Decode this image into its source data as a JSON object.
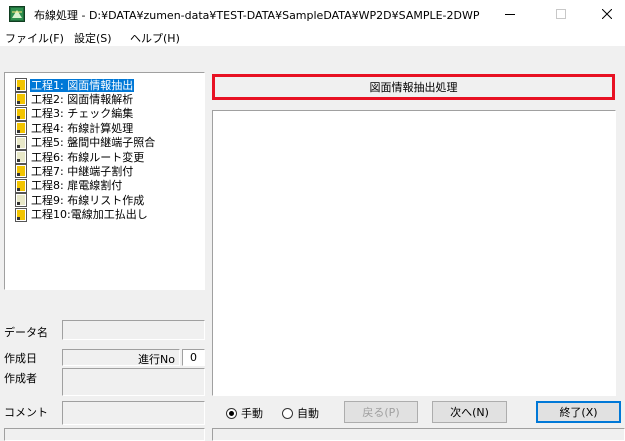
{
  "window": {
    "title": "布線処理 - D:¥DATA¥zumen-data¥TEST-DATA¥SampleDATA¥WP2D¥SAMPLE-2DWP",
    "app_icon": "app-icon",
    "controls": [
      "minimize-icon",
      "maximize-icon",
      "close-icon"
    ]
  },
  "menu": [
    {
      "label": "ファイル(F)"
    },
    {
      "label": "設定(S)"
    },
    {
      "label": "ヘルプ(H)"
    }
  ],
  "steps": [
    {
      "label": "工程1: 図面情報抽出",
      "selected": true,
      "icon_color": "#f2c400"
    },
    {
      "label": "工程2: 図面情報解析",
      "selected": false,
      "icon_color": "#f2c400"
    },
    {
      "label": "工程3: チェック編集",
      "selected": false,
      "icon_color": "#f2c400"
    },
    {
      "label": "工程4: 布線計算処理",
      "selected": false,
      "icon_color": "#f2c400"
    },
    {
      "label": "工程5: 盤間中継端子照合",
      "selected": false,
      "icon_color": "#e8e8c8"
    },
    {
      "label": "工程6: 布線ルート変更",
      "selected": false,
      "icon_color": "#e8e8c8"
    },
    {
      "label": "工程7: 中継端子割付",
      "selected": false,
      "icon_color": "#f2c400"
    },
    {
      "label": "工程8: 扉電線割付",
      "selected": false,
      "icon_color": "#f2c400"
    },
    {
      "label": "工程9: 布線リスト作成",
      "selected": false,
      "icon_color": "#e8e8c8"
    },
    {
      "label": "工程10:電線加工払出し",
      "selected": false,
      "icon_color": "#f2c400"
    }
  ],
  "info": {
    "data_name_label": "データ名",
    "created_date_label": "作成日",
    "progress_no_label": "進行No",
    "progress_no_value": "0",
    "author_label": "作成者",
    "comment_label": "コメント"
  },
  "process": {
    "button_label": "図面情報抽出処理",
    "highlight_color": "#e81123"
  },
  "controls": {
    "manual_label": "手動",
    "auto_label": "自動",
    "mode_selected": "manual",
    "back_label": "戻る(P)",
    "next_label": "次へ(N)",
    "finish_label": "終了(X)"
  }
}
